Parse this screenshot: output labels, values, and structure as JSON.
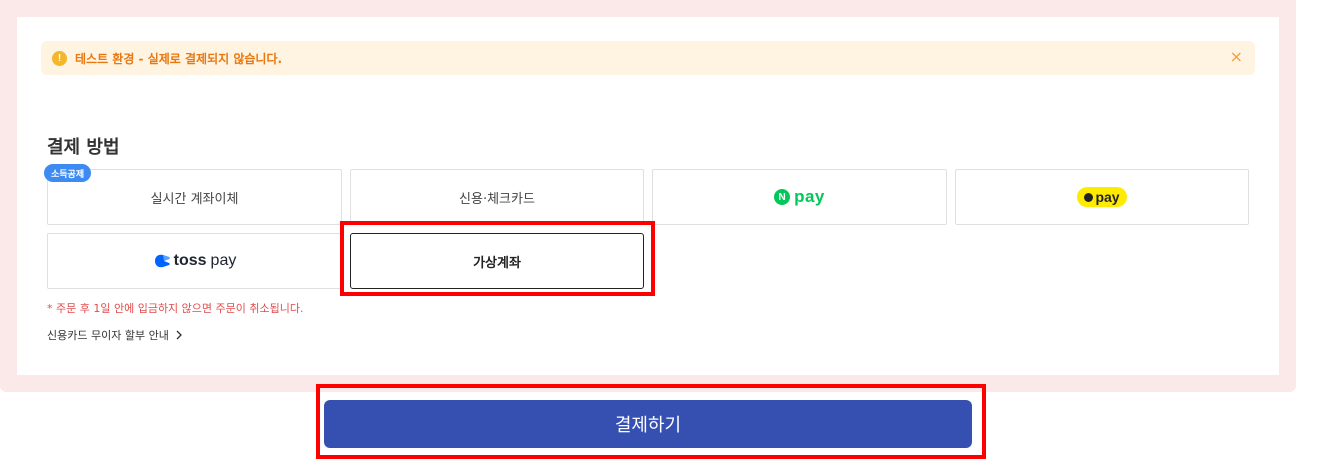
{
  "notice": {
    "icon": "exclamation-icon",
    "icon_glyph": "!",
    "text": "테스트 환경 - 실제로 결제되지 않습니다.",
    "close_glyph": "×"
  },
  "section_title": "결제 방법",
  "methods": {
    "realtime_transfer": {
      "label": "실시간 계좌이체",
      "badge": "소득공제"
    },
    "credit_card": {
      "label": "신용·체크카드"
    },
    "npay": {
      "mark": "N",
      "label": "pay",
      "brand_color": "#03c75a"
    },
    "kakaopay": {
      "label": "pay",
      "brand_color": "#ffeb00"
    },
    "tosspay": {
      "brand": "toss",
      "label": "pay",
      "brand_color": "#0064ff"
    },
    "virtual_account": {
      "label": "가상계좌",
      "selected": true
    }
  },
  "warning_text": "* 주문 후 1일 안에 입금하지 않으면 주문이 취소됩니다.",
  "installment_link": {
    "label": "신용카드 무이자 할부 안내",
    "icon": "chevron-right-icon"
  },
  "pay_button": {
    "label": "결제하기",
    "color": "#3650b2"
  },
  "highlight_color": "#ff0000"
}
